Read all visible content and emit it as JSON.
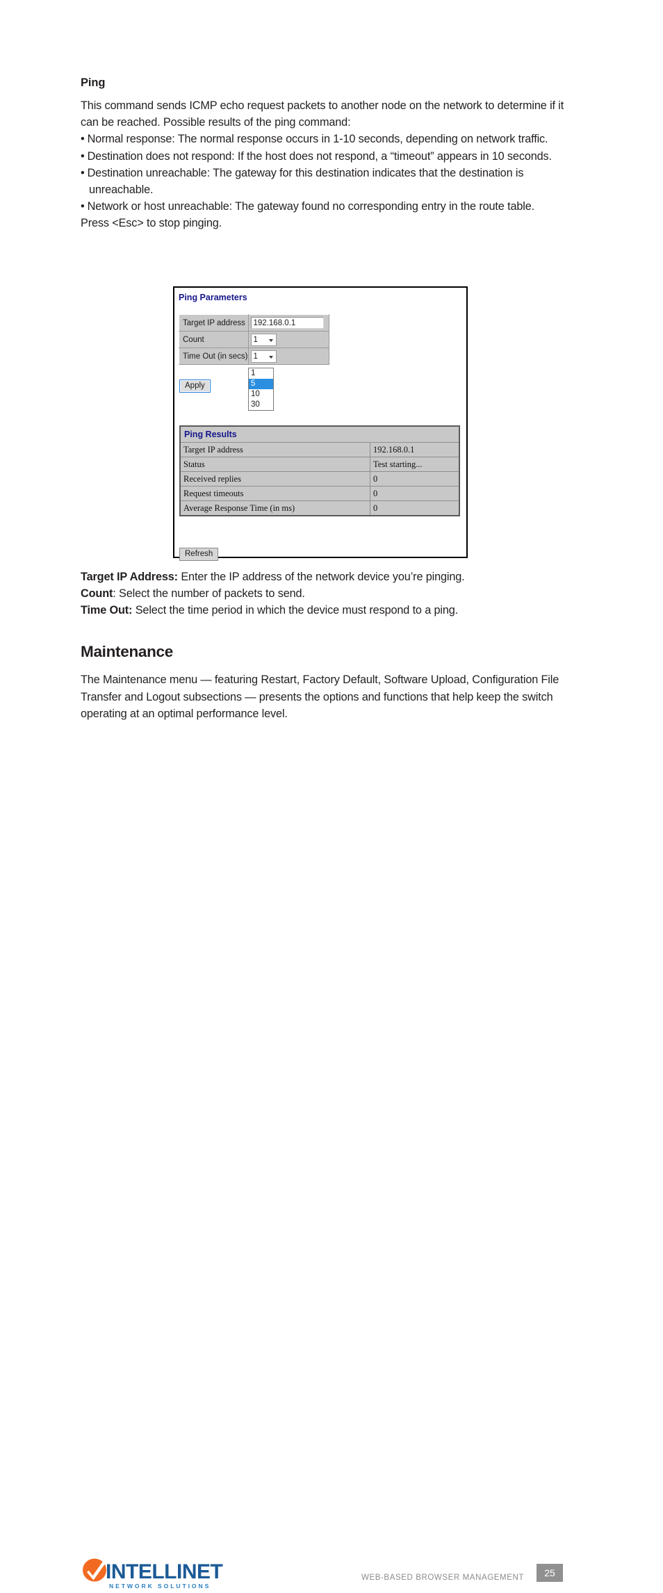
{
  "doc": {
    "section_heading": "Ping",
    "intro": "This command sends ICMP echo request packets to another node on the network to determine if it can be reached. Possible results of the ping command:",
    "bullets": [
      "Normal response: The normal response occurs in 1-10 seconds, depending on network traffic.",
      "Destination does not respond: If the host does not respond, a “timeout” appears in 10 seconds.",
      "Destination unreachable: The gateway for this destination indicates that the destination is unreachable.",
      "Network or host unreachable: The gateway found no corresponding entry in the route table."
    ],
    "bullet_marker": "•",
    "press_esc": "Press <Esc> to stop pinging.",
    "definitions": [
      {
        "term": "Target IP Address:",
        "desc": " Enter the IP address of the network device you’re pinging."
      },
      {
        "term": "Count",
        "desc": ": Select the number of packets to send."
      },
      {
        "term": "Time Out:",
        "desc": " Select the time period in which the device must respond to a ping."
      }
    ],
    "maintenance_heading": "Maintenance",
    "maintenance_body": "The Maintenance menu — featuring Restart, Factory Default, Software Upload, Configuration File Transfer and Logout subsections — presents the options and functions that help keep the switch operating at an optimal performance level."
  },
  "screenshot": {
    "ping_parameters": {
      "title": "Ping Parameters",
      "rows": [
        {
          "label": "Target IP address",
          "control": "textbox",
          "value": "192.168.0.1"
        },
        {
          "label": "Count",
          "control": "select",
          "value": "1"
        },
        {
          "label": "Time Out (in secs)",
          "control": "select",
          "value": "1"
        }
      ],
      "apply_label": "Apply",
      "dropdown": {
        "open": true,
        "options": [
          "1",
          "5",
          "10",
          "30"
        ],
        "highlighted": "5"
      }
    },
    "ping_results": {
      "title": "Ping Results",
      "rows": [
        {
          "key": "Target IP address",
          "value": "192.168.0.1"
        },
        {
          "key": "Status",
          "value": "Test starting..."
        },
        {
          "key": "Received replies",
          "value": "0"
        },
        {
          "key": "Request timeouts",
          "value": "0"
        },
        {
          "key": "Average Response Time (in ms)",
          "value": "0"
        }
      ],
      "refresh_label": "Refresh"
    }
  },
  "footer": {
    "brand": "INTELLINET",
    "tagline": "N E T W O R K   S O L U T I O N S",
    "running_head": "WEB-BASED BROWSER MANAGEMENT",
    "page_number": "25"
  },
  "colors": {
    "panel_heading_blue": "#16168c",
    "table_gray": "#c8c8c8",
    "dropdown_highlight": "#2a8fe0",
    "logo_orange": "#f26a21",
    "logo_blue": "#1b5a96",
    "logo_light_blue": "#2a7ec0",
    "badge_gray": "#909090",
    "footer_text_gray": "#8b8b8b",
    "text_black": "#231f20"
  }
}
